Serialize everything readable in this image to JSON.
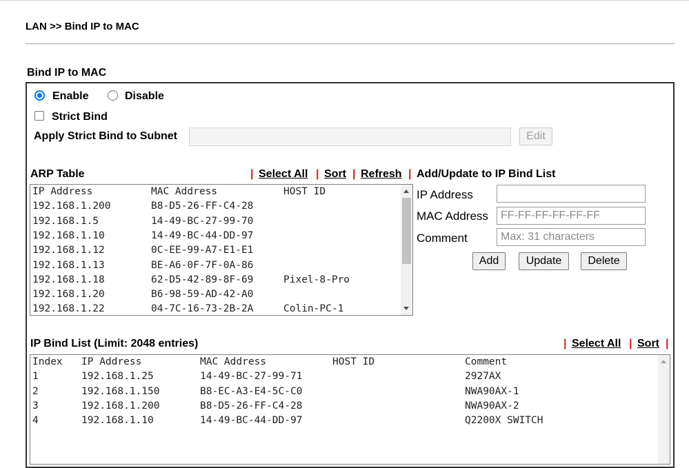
{
  "breadcrumb": "LAN >> Bind IP to MAC",
  "section_title": "Bind IP to MAC",
  "mode": {
    "enable_label": "Enable",
    "disable_label": "Disable",
    "selected": "Enable"
  },
  "strict_bind": {
    "label": "Strict Bind",
    "checked": false,
    "subnet_label": "Apply Strict Bind to Subnet",
    "subnet_value": "",
    "edit_label": "Edit"
  },
  "arp_table": {
    "title": "ARP Table",
    "select_all": "Select All",
    "sort": "Sort",
    "refresh": "Refresh",
    "separator": "|",
    "columns": [
      "IP Address",
      "MAC Address",
      "HOST ID"
    ],
    "rows": [
      [
        "192.168.1.200",
        "B8-D5-26-FF-C4-28",
        ""
      ],
      [
        "192.168.1.5",
        "14-49-BC-27-99-70",
        ""
      ],
      [
        "192.168.1.10",
        "14-49-BC-44-DD-97",
        ""
      ],
      [
        "192.168.1.12",
        "0C-EE-99-A7-E1-E1",
        ""
      ],
      [
        "192.168.1.13",
        "BE-A6-0F-7F-0A-86",
        ""
      ],
      [
        "192.168.1.18",
        "62-D5-42-89-8F-69",
        "Pixel-8-Pro"
      ],
      [
        "192.168.1.20",
        "B6-98-59-AD-42-A0",
        ""
      ],
      [
        "192.168.1.22",
        "04-7C-16-73-2B-2A",
        "Colin-PC-1"
      ]
    ]
  },
  "add_update": {
    "title": "Add/Update to IP Bind List",
    "ip_label": "IP Address",
    "ip_value": "",
    "mac_label": "MAC Address",
    "mac_placeholder": "FF-FF-FF-FF-FF-FF",
    "comment_label": "Comment",
    "comment_placeholder": "Max: 31 characters",
    "add_label": "Add",
    "update_label": "Update",
    "delete_label": "Delete"
  },
  "bind_list": {
    "title": "IP Bind List (Limit: 2048 entries)",
    "select_all": "Select All",
    "sort": "Sort",
    "separator": "|",
    "columns": [
      "Index",
      "IP Address",
      "MAC Address",
      "HOST ID",
      "Comment"
    ],
    "rows": [
      [
        "1",
        "192.168.1.25",
        "14-49-BC-27-99-71",
        "",
        "2927AX"
      ],
      [
        "2",
        "192.168.1.150",
        "B8-EC-A3-E4-5C-C0",
        "",
        "NWA90AX-1"
      ],
      [
        "3",
        "192.168.1.200",
        "B8-D5-26-FF-C4-28",
        "",
        "NWA90AX-2"
      ],
      [
        "4",
        "192.168.1.10",
        "14-49-BC-44-DD-97",
        "",
        "Q2200X SWITCH"
      ]
    ]
  },
  "colors": {
    "accent": "#0075ff",
    "separator": "#d42020",
    "panel_border": "#333333"
  }
}
